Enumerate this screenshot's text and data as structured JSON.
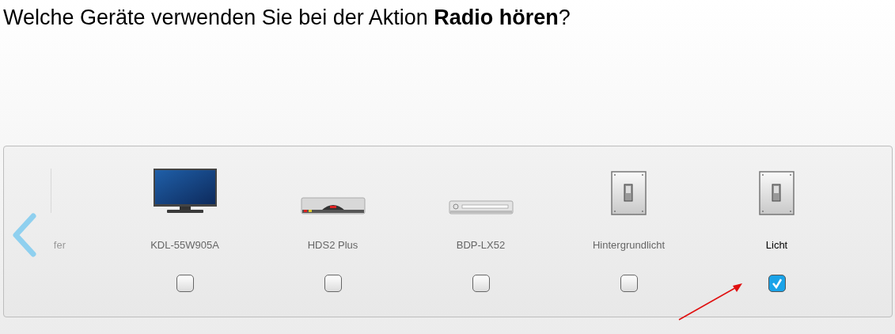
{
  "question": "Welche Geräte verwenden Sie bei der Aktion **Radio hören**?",
  "carousel": {
    "partial_item": {
      "label": "fer"
    },
    "items": [
      {
        "kind": "tv",
        "label": "KDL-55W905A",
        "checked": false
      },
      {
        "kind": "receiver",
        "label": "HDS2 Plus",
        "checked": false
      },
      {
        "kind": "player",
        "label": "BDP-LX52",
        "checked": false
      },
      {
        "kind": "switch",
        "label": "Hintergrundlicht",
        "checked": false
      },
      {
        "kind": "switch",
        "label": "Licht",
        "checked": true
      }
    ]
  }
}
